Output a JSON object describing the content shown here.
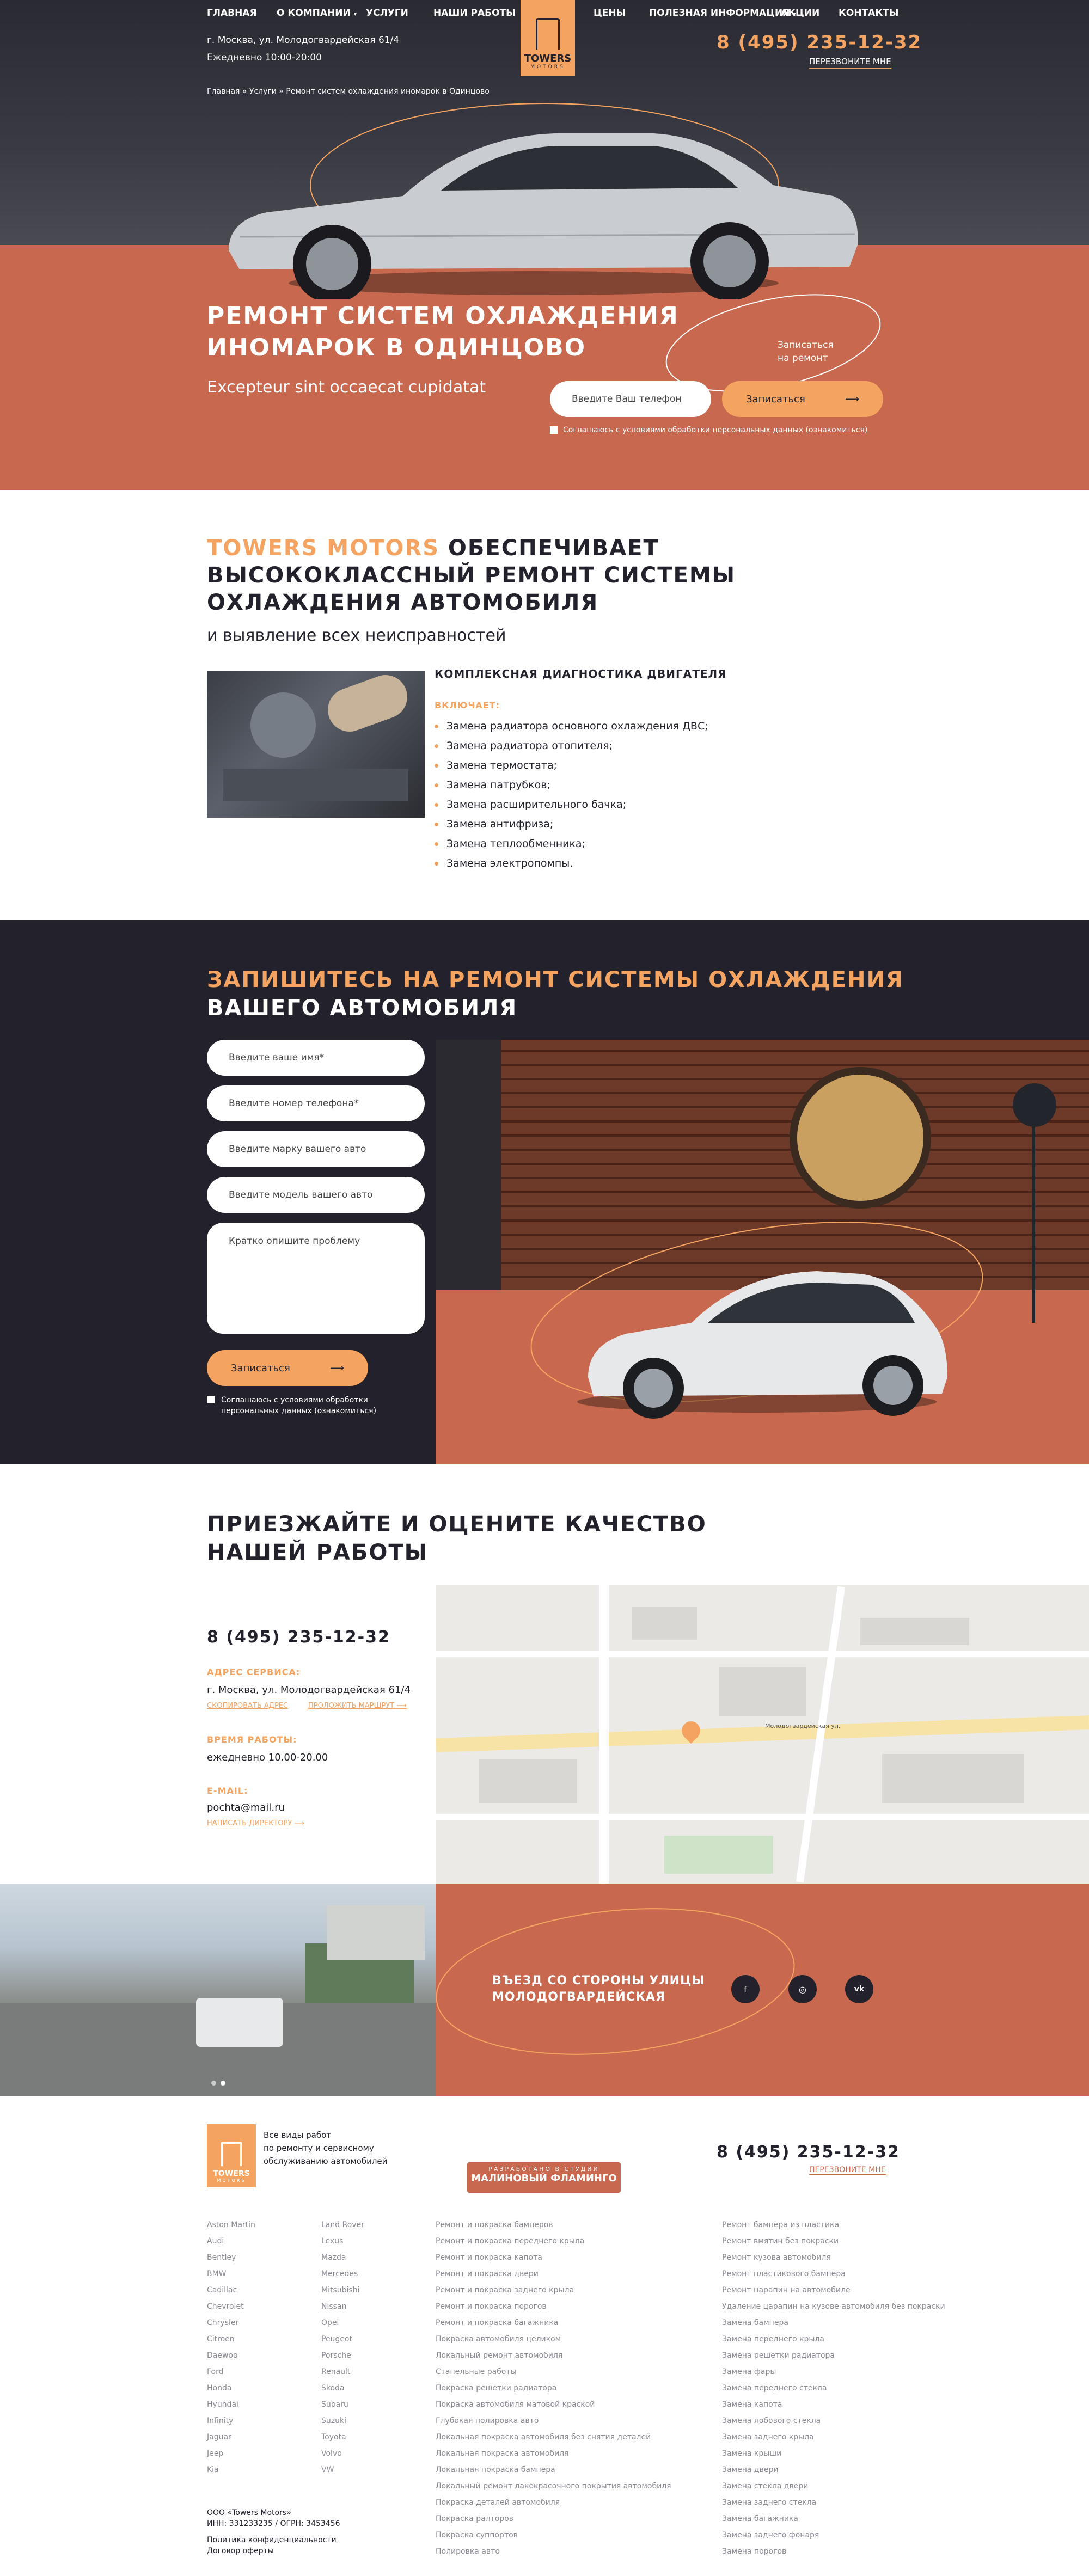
{
  "nav": {
    "left": [
      "Главная",
      "О компании",
      "Услуги",
      "Наши работы"
    ],
    "right": [
      "Цены",
      "Полезная информация",
      "Акции",
      "Контакты"
    ],
    "address": "г. Москва, ул. Молодогвардейская 61/4",
    "hours": "Ежедневно 10:00-20:00",
    "logo": "TOWERS",
    "logo_sub": "motors",
    "phone": "8 (495) 235-12-32",
    "callback": "Перезвоните мне"
  },
  "breadcrumb": "Главная » Услуги » Ремонт систем охлаждения иномарок в Одинцово",
  "hero": {
    "title_line1": "Ремонт систем охлаждения",
    "title_line2": "иномарок в Одинцово",
    "subtitle": "Excepteur sint occaecat cupidatat",
    "phone_placeholder": "Введите Ваш телефон",
    "submit": "Записаться",
    "consent_prefix": "Соглашаюсь с условиями обработки персональных данных (",
    "consent_link": "ознакомиться",
    "consent_suffix": ")",
    "side_note_line1": "Записаться",
    "side_note_line2": "на ремонт"
  },
  "about": {
    "brand": "TOWERS MOTORS",
    "title_rest1": "обеспечивает",
    "title_line2": "высококлассный ремонт системы",
    "title_line3": "охлаждения автомобиля",
    "subtitle": "и выявление всех неисправностей",
    "block_title": "Комплексная диагностика двигателя",
    "includes_label": "Включает:",
    "items": [
      "Замена радиатора основного охлаждения ДВС;",
      "Замена радиатора отопителя;",
      "Замена термостата;",
      "Замена патрубков;",
      "Замена расширительного бачка;",
      "Замена антифриза;",
      "Замена теплообменника;",
      "Замена электропомпы."
    ]
  },
  "signup": {
    "title_line1": "Запишитесь на ремонт системы охлаждения",
    "title_line2": "вашего автомобиля",
    "fields": [
      "Введите ваше имя*",
      "Введите номер телефона*",
      "Введите марку вашего авто",
      "Введите модель вашего авто"
    ],
    "textarea": "Кратко опишите проблему",
    "submit": "Записаться",
    "consent_line1": "Соглашаюсь с условиями обработки",
    "consent_line2_prefix": "персональных данных (",
    "consent_link": "ознакомиться",
    "consent_suffix": ")"
  },
  "contacts": {
    "title_line1": "Приезжайте и оцените качество",
    "title_line2": "нашей работы",
    "phone": "8 (495) 235-12-32",
    "address_label": "Адрес сервиса:",
    "address": "г. Москва, ул. Молодогвардейская 61/4",
    "copy_address": "Скопировать адрес",
    "route": "Проложить маршрут",
    "hours_label": "Время работы:",
    "hours": "ежедневно 10.00-20.00",
    "email_label": "E-mail:",
    "email": "pochta@mail.ru",
    "write": "Написать директору",
    "map_street": "Молодогвардейская ул."
  },
  "entry": {
    "line1": "Въезд со стороны улицы",
    "line2": "Молодогвардейская",
    "social": [
      "f",
      "◎",
      "vk"
    ]
  },
  "footer": {
    "logo": "TOWERS",
    "logo_sub": "motors",
    "desc": [
      "Все виды работ",
      "по ремонту и сервисному",
      "обслуживанию автомобилей"
    ],
    "studio_top": "Разработано в студии",
    "studio": "Малиновый Фламинго",
    "phone": "8 (495) 235-12-32",
    "callback": "Перезвоните мне",
    "brands1": [
      "Aston Martin",
      "Audi",
      "Bentley",
      "BMW",
      "Cadillac",
      "Chevrolet",
      "Chrysler",
      "Citroen",
      "Daewoo",
      "Ford",
      "Honda",
      "Hyundai",
      "Infinity",
      "Jaguar",
      "Jeep",
      "Kia"
    ],
    "brands2": [
      "Land Rover",
      "Lexus",
      "Mazda",
      "Mercedes",
      "Mitsubishi",
      "Nissan",
      "Opel",
      "Peugeot",
      "Porsche",
      "Renault",
      "Skoda",
      "Subaru",
      "Suzuki",
      "Toyota",
      "Volvo",
      "VW"
    ],
    "services1": [
      "Ремонт и покраска бамперов",
      "Ремонт и покраска переднего крыла",
      "Ремонт и покраска капота",
      "Ремонт и покраска двери",
      "Ремонт и покраска заднего крыла",
      "Ремонт и покраска порогов",
      "Ремонт и покраска багажника",
      "Покраска автомобиля целиком",
      "Локальный ремонт автомобиля",
      "Стапельные работы",
      "Покраска решетки радиатора",
      "Покраска автомобиля матовой краской",
      "Глубокая полировка авто",
      "Локальная покраска автомобиля без снятия деталей",
      "Локальная покраска автомобиля",
      "Локальная покраска бампера",
      "Локальный ремонт лакокрасочного покрытия автомобиля",
      "Покраска деталей автомобиля",
      "Покраска ралторов",
      "Покраска суппортов",
      "Полировка авто"
    ],
    "services2": [
      "Ремонт бампера из пластика",
      "Ремонт вмятин без покраски",
      "Ремонт кузова автомобиля",
      "Ремонт пластикового бампера",
      "Ремонт царапин на автомобиле",
      "Удаление царапин на кузове автомобиля без покраски",
      "Замена бампера",
      "Замена переднего крыла",
      "Замена решетки радиатора",
      "Замена фары",
      "Замена переднего стекла",
      "Замена капота",
      "Замена лобового стекла",
      "Замена заднего крыла",
      "Замена крыши",
      "Замена двери",
      "Замена стекла двери",
      "Замена заднего стекла",
      "Замена багажника",
      "Замена заднего фонаря",
      "Замена порогов"
    ],
    "company": "ООО «Towers Motors»",
    "inn": "ИНН: 331233235 / ОГРН: 3453456",
    "privacy": "Политика конфиденциальности",
    "offer": "Договор оферты"
  },
  "colors": {
    "dark": "#23222c",
    "terracotta": "#c8694f",
    "accent": "#f4a460"
  }
}
